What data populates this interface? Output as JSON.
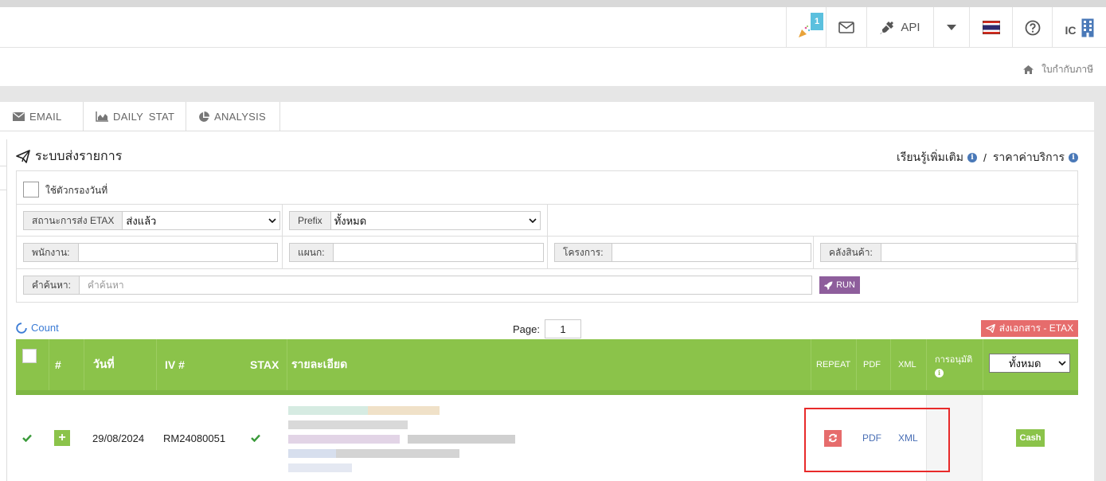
{
  "topbar": {
    "notif_badge": "1",
    "api_label": "API",
    "user_label": "IC"
  },
  "breadcrumb": {
    "current": "ใบกำกับภาษี"
  },
  "tabs": [
    {
      "label": "EMAIL"
    },
    {
      "label": "DAILY STAT"
    },
    {
      "label": "ANALYSIS"
    }
  ],
  "section": {
    "title": "ระบบส่งรายการ",
    "learn_more": "เรียนรู้เพิ่มเติม",
    "separator": "/",
    "pricing": "ราคาค่าบริการ"
  },
  "filters": {
    "date_filter_label": "ใช้ตัวกรองวันที่",
    "etax_status_label": "สถานะการส่ง ETAX",
    "etax_status_value": "ส่งแล้ว",
    "prefix_label": "Prefix",
    "prefix_value": "ทั้งหมด",
    "employee_label": "พนักงาน:",
    "department_label": "แผนก:",
    "project_label": "โครงการ:",
    "warehouse_label": "คลังสินค้า:",
    "search_label": "คำค้นหา:",
    "search_placeholder": "คำค้นหา",
    "run_label": "RUN"
  },
  "toolbar": {
    "count_label": "Count",
    "page_label": "Page:",
    "page_value": "1",
    "send_label": "ส่งเอกสาร - ETAX"
  },
  "table": {
    "headers": {
      "num": "#",
      "date": "วันที่",
      "iv": "IV #",
      "stax": "STAX",
      "detail": "รายละเอียด",
      "repeat": "REPEAT",
      "pdf": "PDF",
      "xml": "XML",
      "approval": "การอนุมัติ",
      "filter_value": "ทั้งหมด"
    },
    "rows": [
      {
        "date": "29/08/2024",
        "iv": "RM24080051",
        "pdf": "PDF",
        "xml": "XML",
        "status": "Cash"
      }
    ]
  },
  "colors": {
    "table_green": "#8bc34a",
    "accent_red": "#e66c6c",
    "run_purple": "#8e5e9c",
    "link_blue": "#4a6fb5"
  }
}
